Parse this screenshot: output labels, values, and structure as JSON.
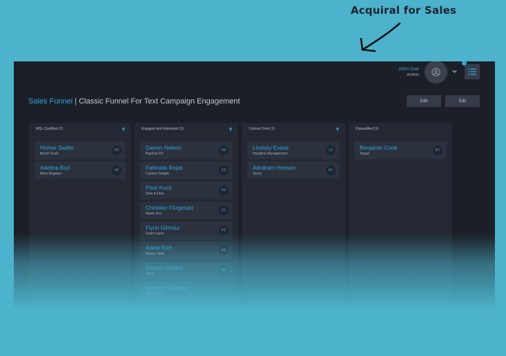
{
  "promo": {
    "title": "Acquiral for Sales"
  },
  "header": {
    "user_name": "John Doe",
    "user_role": "ADMIN",
    "avatar_icon": "user-circle-icon",
    "chevron_icon": "chevron-down-icon",
    "menu_icon": "list-icon"
  },
  "page": {
    "title_accent": "Sales Funnel",
    "title_separator": " | ",
    "title_rest": "Classic Funnel For Text Campaign Engagement",
    "edit_label_1": "Edit",
    "edit_label_2": "Edit"
  },
  "colors": {
    "accent": "#2fa6d8",
    "background": "#4db3cc",
    "app_bg": "#1b1f27"
  },
  "columns": [
    {
      "title": "MQL Qualified (7)",
      "cards": [
        {
          "name": "Homer Sadler",
          "company": "Brook Truck",
          "initials": "HS"
        },
        {
          "name": "Adelina Burt",
          "company": "Mark Register",
          "initials": "AB"
        }
      ]
    },
    {
      "title": "Engaged and Interested (3)",
      "cards": [
        {
          "name": "Darren Nelson",
          "company": "Pipeline NY",
          "initials": "DN"
        },
        {
          "name": "Fahmida Rojas",
          "company": "Cuisine Delight",
          "initials": "FR"
        },
        {
          "name": "Pixie Koch",
          "company": "Dine & Dine",
          "initials": "PK"
        },
        {
          "name": "Christian Fitzgerald",
          "company": "Metric Pro",
          "initials": "CF"
        },
        {
          "name": "Flynn Gilmour",
          "company": "Gold Fusion",
          "initials": "FG"
        },
        {
          "name": "Adele Rich",
          "company": "Burger Stop",
          "initials": "AR"
        },
        {
          "name": "Aayush Ballard",
          "company": "Sinur",
          "initials": "AB"
        },
        {
          "name": "Jasmine Thomas",
          "company": "Nova Kids",
          "initials": "JT"
        }
      ]
    },
    {
      "title": "Contract Sent (1)",
      "cards": [
        {
          "name": "Lindsey Evans",
          "company": "Headline Management",
          "initials": "LE"
        },
        {
          "name": "Abraham Henson",
          "company": "Tesny",
          "initials": "AH"
        }
      ]
    },
    {
      "title": "Disqualified (1)",
      "cards": [
        {
          "name": "Benjamin Cook",
          "company": "Target",
          "initials": "BC"
        }
      ]
    }
  ]
}
